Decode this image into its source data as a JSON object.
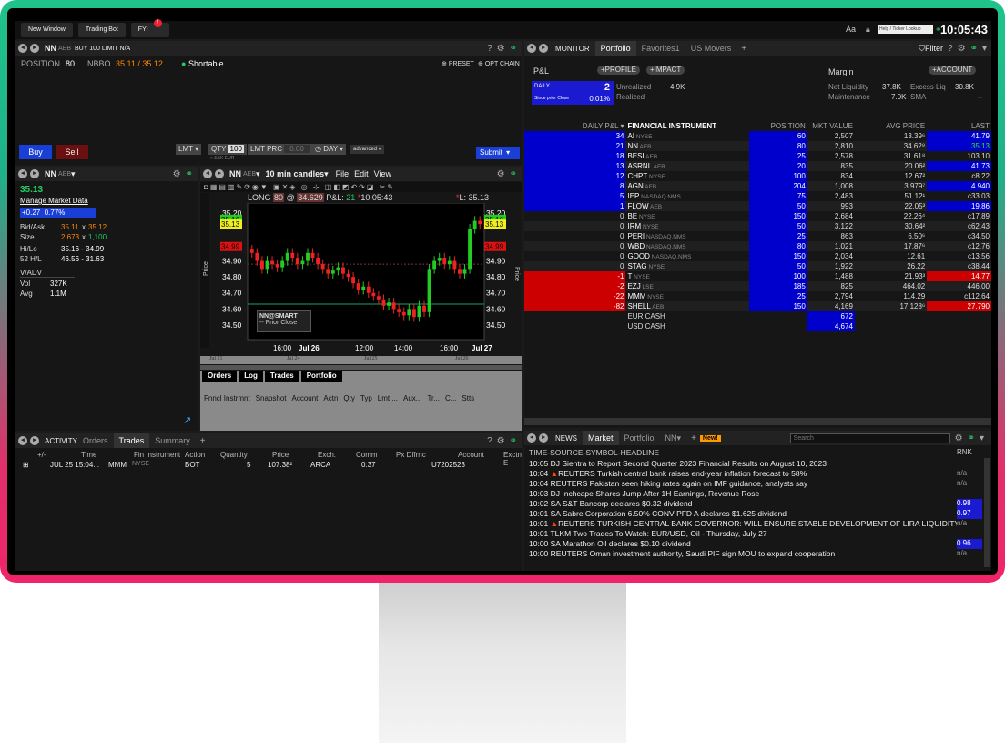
{
  "topbar": {
    "buttons": [
      "New Window",
      "Trading Bot",
      "FYI"
    ],
    "fyi_badge": "!",
    "aa": "Aa",
    "search_placeholder": "Help / Ticker Lookup",
    "clock": "10:05:43"
  },
  "order_panel": {
    "symbol": "NN",
    "exchange": "AEB",
    "order_desc": "BUY 100 LIMIT N/A",
    "position_label": "POSITION",
    "position": "80",
    "nbbo_label": "NBBO",
    "nbbo": "35.11 / 35.12",
    "shortable": "Shortable",
    "preset": "PRESET",
    "opt_chain": "OPT CHAIN",
    "buy": "Buy",
    "sell": "Sell",
    "type": "LMT",
    "qty_label": "QTY",
    "qty": "100",
    "lmt_label": "LMT PRC",
    "lmt": "0.00",
    "tif": "DAY",
    "advanced": "advanced",
    "est": "≈ 3.5K EUR",
    "submit": "Submit"
  },
  "quote_panel": {
    "symbol": "NN",
    "exchange": "AEB",
    "last": "35.13",
    "manage": "Manage Market Data",
    "change": "+0.27",
    "change_pct": "0.77%",
    "bidask_label": "Bid/Ask",
    "bid": "35.11",
    "ask": "35.12",
    "size_label": "Size",
    "bid_size": "2,673",
    "ask_size": "1,100",
    "hilo_label": "Hi/Lo",
    "hilo": "35.16 - 34.99",
    "h52_label": "52 H/L",
    "h52": "46.56 - 31.63",
    "vadv_label": "V/ADV",
    "vol_label": "Vol",
    "vol": "327K",
    "avg_label": "Avg",
    "avg": "1.1M"
  },
  "chart_panel": {
    "symbol": "NN",
    "exchange": "AEB",
    "period": "10 min candles",
    "menu": [
      "File",
      "Edit",
      "View"
    ],
    "status_long": "LONG",
    "status_qty": "80",
    "status_at": "@",
    "status_price": "34.629",
    "pl_label": "P&L:",
    "pl": "21",
    "time": "10:05:43",
    "last_label": "L: 35.13",
    "routing": "NN@SMART",
    "prior_close": "Prior Close",
    "price_axis": "Price",
    "x_ticks": [
      "16:00",
      "Jul 26",
      "12:00",
      "14:00",
      "16:00",
      "Jul 27"
    ],
    "nav_ticks": [
      "Jul 21",
      "Jul 24",
      "Jul 25",
      "Jul 26"
    ],
    "y_ticks": [
      "35.20",
      "35.00",
      "34.90",
      "34.80",
      "34.70",
      "34.60",
      "34.50"
    ],
    "tag_bid": "35.16",
    "tag_last": "35.13",
    "tag_low": "34.99"
  },
  "chart_data": {
    "type": "candlestick",
    "series": [
      {
        "values": [
          34.95,
          34.9,
          34.85,
          34.9,
          34.88,
          34.86,
          34.9,
          34.95,
          34.92,
          34.88,
          34.9,
          34.95,
          34.92,
          34.88,
          34.85,
          34.82,
          34.84,
          34.86,
          34.82,
          34.8,
          34.76,
          34.72,
          34.74,
          34.7,
          34.68,
          34.66,
          34.62,
          34.64,
          34.6,
          34.58,
          34.56,
          34.6,
          34.55,
          34.62,
          34.58,
          34.85,
          34.9,
          34.92,
          34.88,
          34.9,
          34.85,
          34.82,
          34.85,
          35.1,
          35.15,
          35.13
        ]
      }
    ],
    "ylim": [
      34.42,
      35.25
    ]
  },
  "orders_panel": {
    "tabs": [
      "Orders",
      "Log",
      "Trades",
      "Portfolio"
    ],
    "cols": [
      "Fnncl Instrmnt",
      "Snapshot",
      "Account",
      "Actn",
      "Qty",
      "Typ",
      "Lmt ...",
      "Aux...",
      "Tr...",
      "C...",
      "Stts"
    ]
  },
  "activity_panel": {
    "title": "ACTIVITY",
    "tabs": [
      "Orders",
      "Trades",
      "Summary"
    ],
    "cols": [
      "+/-",
      "Time",
      "Fin Instrument",
      "Action",
      "Quantity",
      "Price",
      "Exch.",
      "Comm",
      "Px Dffrnc",
      "Account",
      "Exctng E"
    ],
    "row": {
      "time": "JUL 25 15:04...",
      "sym": "MMM",
      "exch": "NYSE",
      "action": "BOT",
      "qty": "5",
      "price": "107.38²",
      "venue": "ARCA",
      "comm": "0.37",
      "account": "U7202523"
    }
  },
  "monitor": {
    "title": "MONITOR",
    "tabs": [
      "Portfolio",
      "Favorites1",
      "US Movers"
    ],
    "filter": "Filter",
    "pl": "P&L",
    "profile": "PROFILE",
    "impact": "IMPACT",
    "account": "ACCOUNT",
    "margin": "Margin",
    "daily": "DAILY",
    "daily_val": "2",
    "since": "Since prior Close",
    "since_pct": "0.01%",
    "unrealized_label": "Unrealized",
    "unrealized": "4.9K",
    "realized_label": "Realized",
    "netliq_label": "Net Liquidity",
    "netliq": "37.8K",
    "excess_label": "Excess Liq",
    "excess": "30.8K",
    "maint_label": "Maintenance",
    "maint": "7.0K",
    "sma_label": "SMA",
    "sma": "--",
    "cols": [
      "DAILY P&L",
      "FINANCIAL INSTRUMENT",
      "POSITION",
      "MKT VALUE",
      "AVG PRICE",
      "LAST"
    ],
    "rows": [
      [
        "34",
        "AI",
        "NYSE",
        "60",
        "2,507",
        "13.39⁶",
        "41.79",
        "b"
      ],
      [
        "21",
        "NN",
        "AEB",
        "80",
        "2,810",
        "34.62⁹",
        "35.13",
        "g"
      ],
      [
        "18",
        "BESI",
        "AEB",
        "25",
        "2,578",
        "31.61⁸",
        "103.10",
        ""
      ],
      [
        "13",
        "ASRNL",
        "AEB",
        "20",
        "835",
        "20.06²",
        "41.73",
        "b"
      ],
      [
        "12",
        "CHPT",
        "NYSE",
        "100",
        "834",
        "12.67²",
        "c8.22",
        ""
      ],
      [
        "8",
        "AGN",
        "AEB",
        "204",
        "1,008",
        "3.979⁷",
        "4.940",
        "b"
      ],
      [
        "5",
        "IEP",
        "NASDAQ.NMS",
        "75",
        "2,483",
        "51.12¹",
        "c33.03",
        ""
      ],
      [
        "1",
        "FLOW",
        "AEB",
        "50",
        "993",
        "22.05³",
        "19.86",
        "b"
      ],
      [
        "0",
        "BE",
        "NYSE",
        "150",
        "2,684",
        "22.26⁴",
        "c17.89",
        ""
      ],
      [
        "0",
        "IRM",
        "NYSE",
        "50",
        "3,122",
        "30.64²",
        "c62.43",
        ""
      ],
      [
        "0",
        "PERI",
        "NASDAQ.NMS",
        "25",
        "863",
        "6.50⁶",
        "c34.50",
        ""
      ],
      [
        "0",
        "WBD",
        "NASDAQ.NMS",
        "80",
        "1,021",
        "17.87⁶",
        "c12.76",
        ""
      ],
      [
        "0",
        "GOOD",
        "NASDAQ.NMS",
        "150",
        "2,034",
        "12.61",
        "c13.56",
        ""
      ],
      [
        "0",
        "STAG",
        "NYSE",
        "50",
        "1,922",
        "26.22",
        "c38.44",
        ""
      ],
      [
        "-1",
        "T",
        "NYSE",
        "100",
        "1,488",
        "21.93³",
        "14.77",
        "r"
      ],
      [
        "-2",
        "EZJ",
        "LSE",
        "185",
        "825",
        "464.02",
        "446.00",
        ""
      ],
      [
        "-22",
        "MMM",
        "NYSE",
        "25",
        "2,794",
        "114.29",
        "c112.64",
        ""
      ],
      [
        "-82",
        "SHELL",
        "AEB",
        "150",
        "4,169",
        "17.128⁶",
        "27.790",
        "r"
      ]
    ],
    "cash": [
      [
        "EUR CASH",
        "672"
      ],
      [
        "USD CASH",
        "4,674"
      ]
    ]
  },
  "news": {
    "title": "NEWS",
    "tabs": [
      "Market",
      "Portfolio",
      "NN"
    ],
    "new": "New!",
    "search": "Search",
    "header": "TIME-SOURCE-SYMBOL-HEADLINE",
    "rnk": "RNK",
    "items": [
      [
        "10:05 DJ Sientra to Report Second Quarter 2023 Financial Results on August 10, 2023",
        "",
        ""
      ],
      [
        "10:04 ▲REUTERS Turkish central bank raises end-year inflation forecast to 58%",
        "n/a",
        ""
      ],
      [
        "10:04 REUTERS Pakistan seen hiking rates again on IMF guidance, analysts say",
        "n/a",
        ""
      ],
      [
        "10:03 DJ Inchcape Shares Jump After 1H Earnings, Revenue Rose",
        "",
        ""
      ],
      [
        "10:02 SA S&T Bancorp declares $0.32 dividend",
        "0.98",
        "b"
      ],
      [
        "10:01 SA Sabre Corporation 6.50% CONV PFD A declares $1.625 dividend",
        "0.97",
        "b"
      ],
      [
        "10:01 ▲REUTERS TURKISH CENTRAL BANK GOVERNOR: WILL ENSURE STABLE DEVELOPMENT OF LIRA LIQUIDITY",
        "n/a",
        ""
      ],
      [
        "10:01 TLKM Two Trades To Watch: EUR/USD, Oil - Thursday, July 27",
        "",
        ""
      ],
      [
        "10:00 SA Marathon Oil declares $0.10 dividend",
        "0.96",
        "b"
      ],
      [
        "10:00 REUTERS Oman investment authority, Saudi PIF sign MOU to expand cooperation",
        "n/a",
        ""
      ]
    ]
  }
}
